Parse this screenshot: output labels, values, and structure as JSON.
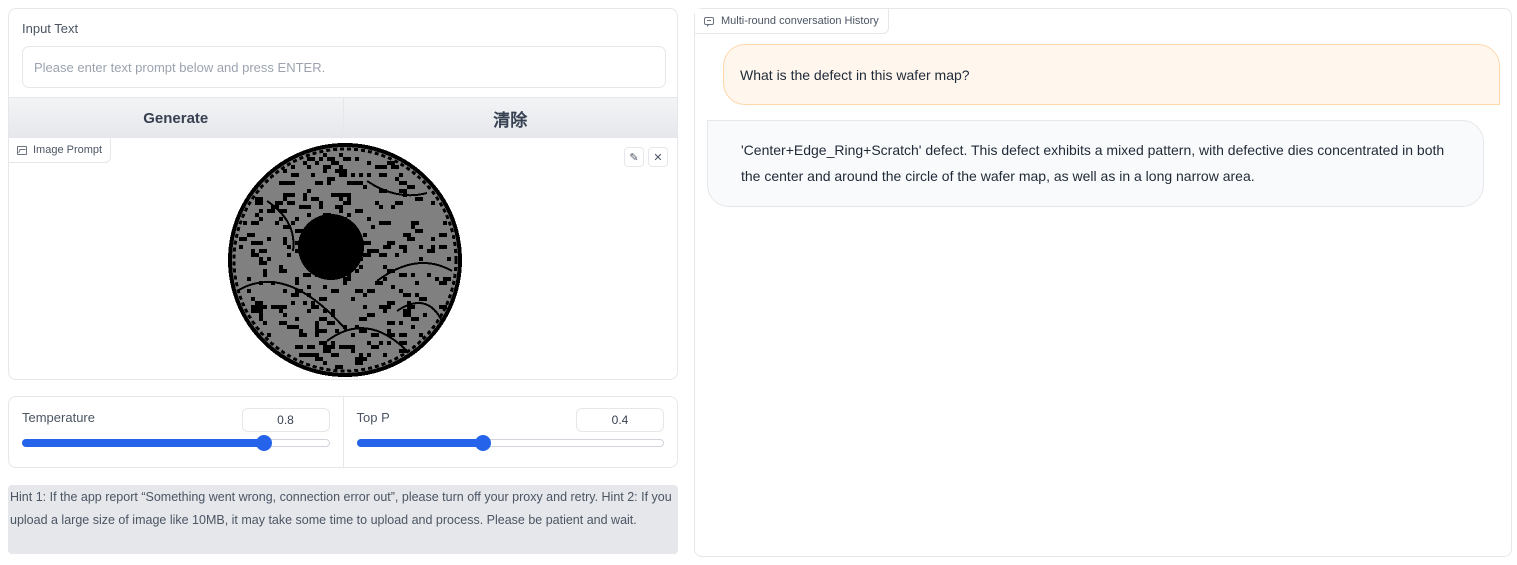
{
  "input": {
    "label": "Input Text",
    "placeholder": "Please enter text prompt below and press ENTER.",
    "value": ""
  },
  "buttons": {
    "generate": "Generate",
    "clear": "清除"
  },
  "image_prompt": {
    "label": "Image Prompt",
    "icon": "image-icon",
    "actions": [
      {
        "name": "edit",
        "icon": "pencil-icon",
        "glyph": "✎"
      },
      {
        "name": "clear",
        "icon": "close-icon",
        "glyph": "✕"
      }
    ]
  },
  "sliders": {
    "temperature": {
      "label": "Temperature",
      "value": "0.8",
      "fraction": 0.79
    },
    "top_p": {
      "label": "Top P",
      "value": "0.4",
      "fraction": 0.41
    }
  },
  "hint": "Hint 1: If the app report “Something went wrong, connection error out”, please turn off your proxy and retry. Hint 2: If you upload a large size of image like 10MB, it may take some time to upload and process. Please be patient and wait.",
  "chat": {
    "label": "Multi-round conversation History",
    "icon": "chat-icon",
    "user_message": "What is the defect in this wafer map?",
    "bot_message": "'Center+Edge_Ring+Scratch' defect. This defect exhibits a mixed pattern, with defective dies concentrated in both the center and around the circle of the wafer map, as well as in a long narrow area."
  },
  "colors": {
    "accent": "#2563eb",
    "user_bubble": "#fff7ed",
    "user_bubble_border": "#fed7aa",
    "bot_bubble": "#f9fafb",
    "wafer_good": "#808080",
    "wafer_defect": "#000000"
  }
}
